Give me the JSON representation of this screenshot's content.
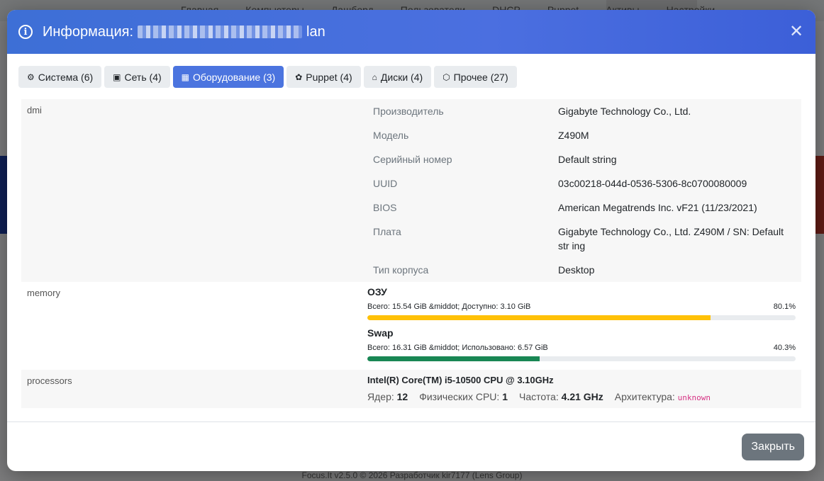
{
  "background": {
    "nav": [
      "Главная",
      "Компьютеры",
      "Дашборд",
      "Пользователи",
      "DHCP",
      "Puppet",
      "Активы",
      "Настройки"
    ],
    "footer": "Focus.It v2.5.0 © 2026 Разработчик kir7177 (Lens Group)"
  },
  "modal": {
    "title_prefix": "Информация:",
    "title_suffix": "lan",
    "tabs": [
      {
        "icon": "cpu-icon",
        "glyph": "⚙",
        "label": "Система (6)"
      },
      {
        "icon": "network-icon",
        "glyph": "▣",
        "label": "Сеть (4)"
      },
      {
        "icon": "hardware-icon",
        "glyph": "▦",
        "label": "Оборудование (3)"
      },
      {
        "icon": "puppet-icon",
        "glyph": "✿",
        "label": "Puppet (4)"
      },
      {
        "icon": "disk-icon",
        "glyph": "⌂",
        "label": "Диски (4)"
      },
      {
        "icon": "box-icon",
        "glyph": "⬡",
        "label": "Прочее (27)"
      }
    ],
    "active_tab": 2,
    "sections": {
      "dmi": {
        "label": "dmi",
        "rows": [
          {
            "k": "Производитель",
            "v": "Gigabyte Technology Co., Ltd."
          },
          {
            "k": "Модель",
            "v": "Z490M"
          },
          {
            "k": "Серийный номер",
            "v": "Default string"
          },
          {
            "k": "UUID",
            "v": "03c00218-044d-0536-5306-8c0700080009"
          },
          {
            "k": "BIOS",
            "v": "American Megatrends Inc. vF21 (11/23/2021)"
          },
          {
            "k": "Плата",
            "v": "Gigabyte Technology Co., Ltd. Z490M / SN: Default str ing"
          },
          {
            "k": "Тип корпуса",
            "v": "Desktop"
          }
        ]
      },
      "memory": {
        "label": "memory",
        "ram": {
          "title": "ОЗУ",
          "text": "Всего: 15.54 GiB &middot; Доступно: 3.10 GiB",
          "percent_label": "80.1%",
          "percent": 80.1,
          "color": "#ffc107"
        },
        "swap": {
          "title": "Swap",
          "text": "Всего: 16.31 GiB &middot; Использовано: 6.57 GiB",
          "percent_label": "40.3%",
          "percent": 40.3,
          "color": "#198754"
        }
      },
      "processors": {
        "label": "processors",
        "name": "Intel(R) Core(TM) i5-10500 CPU @ 3.10GHz",
        "cores_label": "Ядер:",
        "cores": "12",
        "phys_label": "Физических CPU:",
        "phys": "1",
        "freq_label": "Частота:",
        "freq": "4.21 GHz",
        "arch_label": "Архитектура:",
        "arch": "unknown"
      }
    },
    "close_button": "Закрыть"
  }
}
